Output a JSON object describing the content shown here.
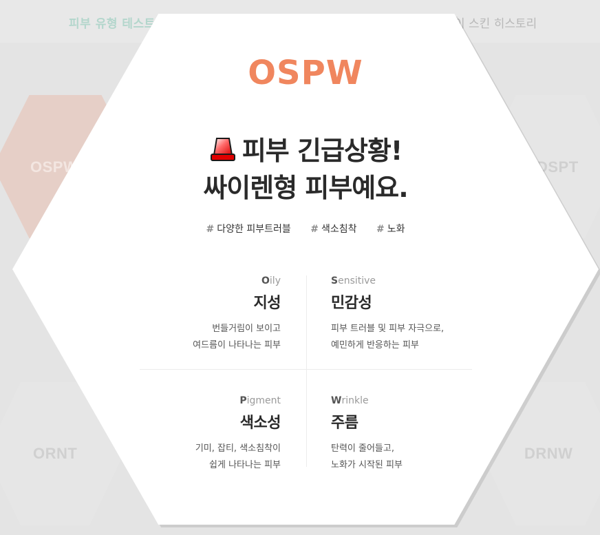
{
  "background": {
    "nav_left": "피부 유형 테스트",
    "nav_right": "이 스킨 히스토리",
    "hex_labels": [
      "OSPW",
      "DSPT",
      "ORNT",
      "DRNW"
    ]
  },
  "result": {
    "code": "OSPW",
    "headline_line1": "피부 긴급상황!",
    "headline_line2": "싸이렌형 피부예요.",
    "tags": [
      "다양한 피부트러블",
      "색소침착",
      "노화"
    ],
    "hash_symbol": "#",
    "traits": [
      {
        "initial": "O",
        "rest": "ily",
        "name": "지성",
        "desc1": "번들거림이 보이고",
        "desc2": "여드름이 나타나는 피부"
      },
      {
        "initial": "S",
        "rest": "ensitive",
        "name": "민감성",
        "desc1": "피부 트러블 및 피부 자극으로,",
        "desc2": "예민하게 반응하는 피부"
      },
      {
        "initial": "P",
        "rest": "igment",
        "name": "색소성",
        "desc1": "기미, 잡티, 색소침착이",
        "desc2": "쉽게 나타나는 피부"
      },
      {
        "initial": "W",
        "rest": "rinkle",
        "name": "주름",
        "desc1": "탄력이 줄어들고,",
        "desc2": "노화가 시작된 피부"
      }
    ]
  },
  "colors": {
    "accent": "#f0865e",
    "background_hex": "#e6cfc7",
    "nav_accent": "#b3d6cc"
  },
  "icons": {
    "headline_icon": "siren-icon"
  }
}
